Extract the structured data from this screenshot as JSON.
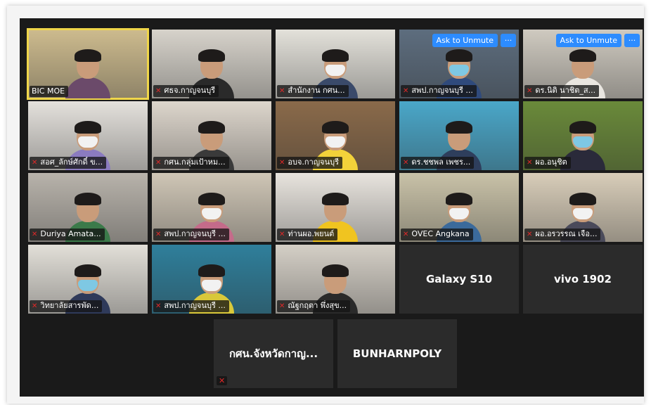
{
  "meeting": {
    "tiles": [
      {
        "id": "t1",
        "name": "BIC MOE",
        "muted": false,
        "active": true,
        "mask": false,
        "bg": "#cdbb8e",
        "shirt": "#6b4a6a"
      },
      {
        "id": "t2",
        "name": "ศธจ.กาญจนบุรี",
        "muted": true,
        "mask": false,
        "bg": "#d7d3cb",
        "shirt": "#2a2a2a"
      },
      {
        "id": "t3",
        "name": "สำนักงาน กศน...",
        "muted": true,
        "mask": true,
        "bg": "#e3e1da",
        "shirt": "#3a4a6a"
      },
      {
        "id": "t4",
        "name": "สพป.กาญจนบุรี ...",
        "muted": true,
        "mask": true,
        "bg": "#5d6d7e",
        "shirt": "#2f4a7c",
        "unmute": "Ask to Unmute",
        "more": "···"
      },
      {
        "id": "t5",
        "name": "ดร.นิติ นาชิต_ส...",
        "muted": true,
        "mask": false,
        "bg": "#cfcac0",
        "shirt": "#e9e6e0",
        "unmute": "Ask to Unmute",
        "more": "···"
      },
      {
        "id": "t6",
        "name": "สอศ_ลักษ์ศักดิ์ ข...",
        "muted": true,
        "mask": true,
        "bg": "#e4e1dc",
        "shirt": "#8b7bc0"
      },
      {
        "id": "t7",
        "name": "กศน.กลุ่มเป้าหม...",
        "muted": true,
        "mask": false,
        "bg": "#ddd6cc",
        "shirt": "#3a3a3a"
      },
      {
        "id": "t8",
        "name": "อบจ.กาญจนบุรี",
        "muted": true,
        "mask": true,
        "bg": "#8a6a4a",
        "shirt": "#f2d23a"
      },
      {
        "id": "t9",
        "name": "ดร.ชชพล เพชร...",
        "muted": true,
        "mask": false,
        "bg": "#4aa7c9",
        "shirt": "#2e3e5c"
      },
      {
        "id": "t10",
        "name": "ผอ.อนุชิต",
        "muted": true,
        "mask": true,
        "bg": "#6a8a3a",
        "shirt": "#2a2a3a"
      },
      {
        "id": "t11",
        "name": "Duriya Amata...",
        "muted": true,
        "mask": false,
        "bg": "#b8b3ab",
        "shirt": "#3b7a4a"
      },
      {
        "id": "t12",
        "name": "สพป.กาญจนบุรี ...",
        "muted": true,
        "mask": true,
        "bg": "#cfc6b6",
        "shirt": "#c46b8a"
      },
      {
        "id": "t13",
        "name": "ท่านผอ.พยนต์",
        "muted": true,
        "mask": false,
        "bg": "#e8e4de",
        "shirt": "#f0c420"
      },
      {
        "id": "t14",
        "name": "OVEC Angkana",
        "muted": true,
        "mask": true,
        "bg": "#c9c2a8",
        "shirt": "#3b6a9b"
      },
      {
        "id": "t15",
        "name": "ผอ.อรวรรณ เจือ...",
        "muted": true,
        "mask": true,
        "bg": "#d8cdb9",
        "shirt": "#4a4a5a"
      },
      {
        "id": "t16",
        "name": "วิทยาลัยสารพัด...",
        "muted": true,
        "mask": true,
        "bg": "#e2dfd8",
        "shirt": "#2f3a5a"
      },
      {
        "id": "t17",
        "name": "สพป.กาญจนบุรี ...",
        "muted": true,
        "mask": true,
        "bg": "#2f7f9b",
        "shirt": "#d9c83a"
      },
      {
        "id": "t18",
        "name": "ณัฐกฤตา พึ่งสุข...",
        "muted": true,
        "mask": false,
        "bg": "#d4cfc6",
        "shirt": "#2a2a2a"
      }
    ],
    "text_tiles": [
      {
        "id": "t19",
        "name": "Galaxy S10"
      },
      {
        "id": "t20",
        "name": "vivo 1902"
      },
      {
        "id": "t21",
        "name": "กศน.จังหวัดกาญ...",
        "muted": true
      },
      {
        "id": "t22",
        "name": "BUNHARNPOLY"
      }
    ],
    "mic_muted_symbol": "✕"
  }
}
